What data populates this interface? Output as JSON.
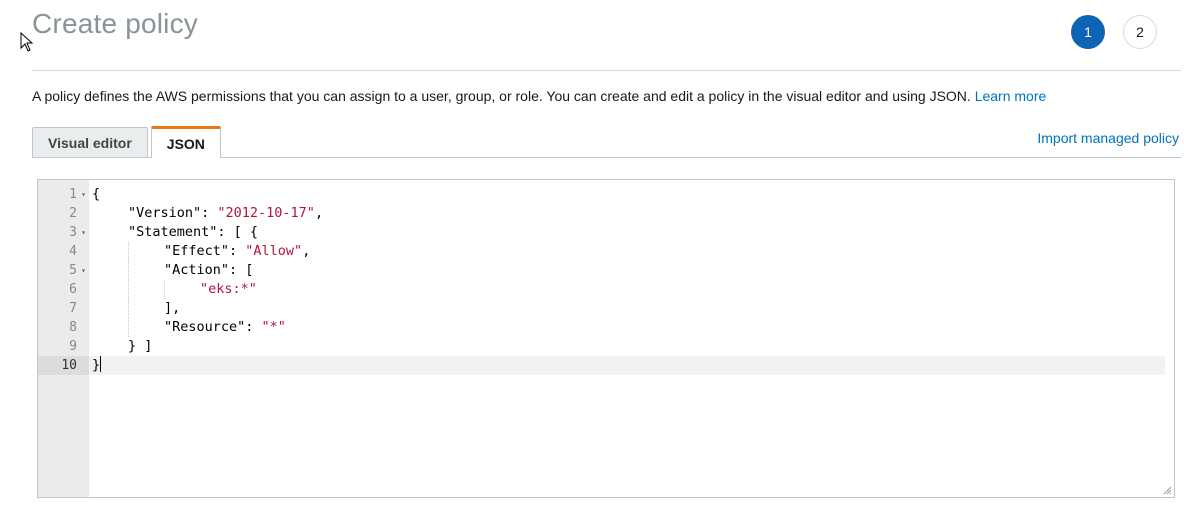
{
  "page": {
    "title": "Create policy",
    "description": "A policy defines the AWS permissions that you can assign to a user, group, or role. You can create and edit a policy in the visual editor and using JSON.",
    "learn_more": "Learn more"
  },
  "steps": [
    {
      "label": "1",
      "active": true
    },
    {
      "label": "2",
      "active": false
    }
  ],
  "tabs": {
    "visual_editor": "Visual editor",
    "json": "JSON",
    "active": "JSON"
  },
  "import_link": "Import managed policy",
  "editor": {
    "current_line": 10,
    "lines": [
      {
        "num": "1",
        "fold": true,
        "indent": 0,
        "tokens": [
          {
            "t": "{",
            "c": "txt"
          }
        ]
      },
      {
        "num": "2",
        "fold": false,
        "indent": 1,
        "tokens": [
          {
            "t": "\"Version\": ",
            "c": "txt"
          },
          {
            "t": "\"2012-10-17\"",
            "c": "str"
          },
          {
            "t": ",",
            "c": "txt"
          }
        ]
      },
      {
        "num": "3",
        "fold": true,
        "indent": 1,
        "tokens": [
          {
            "t": "\"Statement\": [ {",
            "c": "txt"
          }
        ]
      },
      {
        "num": "4",
        "fold": false,
        "indent": 2,
        "tokens": [
          {
            "t": "\"Effect\": ",
            "c": "txt"
          },
          {
            "t": "\"Allow\"",
            "c": "str"
          },
          {
            "t": ",",
            "c": "txt"
          }
        ]
      },
      {
        "num": "5",
        "fold": true,
        "indent": 2,
        "tokens": [
          {
            "t": "\"Action\": [",
            "c": "txt"
          }
        ]
      },
      {
        "num": "6",
        "fold": false,
        "indent": 3,
        "tokens": [
          {
            "t": "\"eks:*\"",
            "c": "str"
          }
        ]
      },
      {
        "num": "7",
        "fold": false,
        "indent": 2,
        "tokens": [
          {
            "t": "],",
            "c": "txt"
          }
        ]
      },
      {
        "num": "8",
        "fold": false,
        "indent": 2,
        "tokens": [
          {
            "t": "\"Resource\": ",
            "c": "txt"
          },
          {
            "t": "\"*\"",
            "c": "str"
          }
        ]
      },
      {
        "num": "9",
        "fold": false,
        "indent": 1,
        "tokens": [
          {
            "t": "} ]",
            "c": "txt"
          }
        ]
      },
      {
        "num": "10",
        "fold": false,
        "indent": 0,
        "tokens": [
          {
            "t": "}",
            "c": "txt"
          }
        ]
      }
    ]
  },
  "colors": {
    "accent_blue": "#0f63b5",
    "link": "#0073bb",
    "tab_highlight": "#e47911",
    "string": "#b5143c"
  },
  "icons": {
    "cursor": "mouse-pointer-icon",
    "fold": "fold-arrow-icon",
    "resize": "resize-handle-icon"
  }
}
